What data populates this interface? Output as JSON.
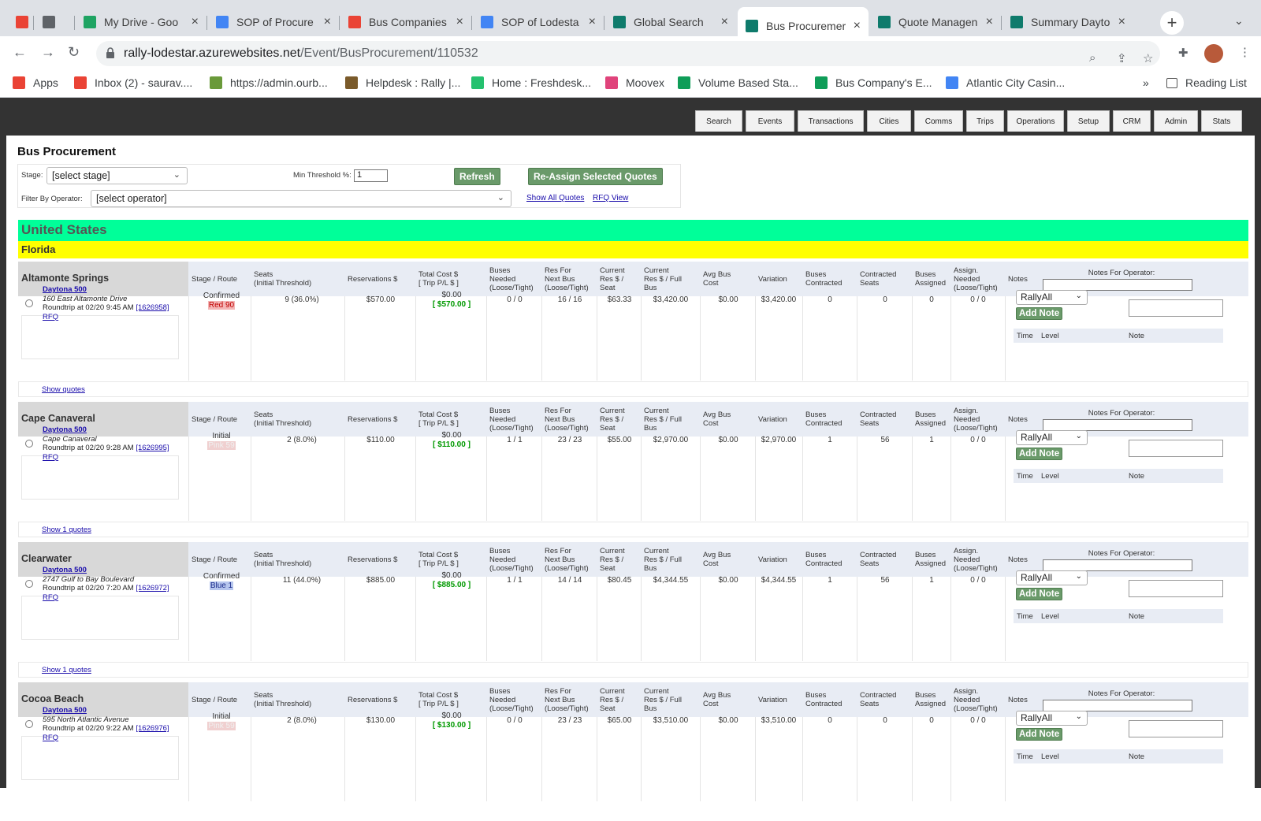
{
  "browser": {
    "tabs": [
      {
        "title": "",
        "icon": "gmail-icon",
        "color": "#ea4335"
      },
      {
        "title": "",
        "icon": "globe-icon",
        "color": "#5f6368"
      },
      {
        "title": "My Drive - Goo",
        "icon": "google-drive-icon",
        "color": "#1fa463"
      },
      {
        "title": "SOP of Procure",
        "icon": "google-docs-icon",
        "color": "#4285f4"
      },
      {
        "title": "Bus Companies",
        "icon": "google-maps-icon",
        "color": "#ea4335"
      },
      {
        "title": "SOP of Lodesta",
        "icon": "google-docs-icon",
        "color": "#4285f4"
      },
      {
        "title": "Global Search",
        "icon": "rally-icon",
        "color": "#0f7b6c"
      },
      {
        "title": "Bus Procuremer",
        "icon": "rally-icon",
        "color": "#0f7b6c",
        "active": true
      },
      {
        "title": "Quote Managen",
        "icon": "rally-icon",
        "color": "#0f7b6c"
      },
      {
        "title": "Summary Dayto",
        "icon": "rally-icon",
        "color": "#0f7b6c"
      }
    ],
    "url_host": "rally-lodestar.azurewebsites.net",
    "url_path": "/Event/BusProcurement/110532",
    "bookmarks": [
      {
        "label": "Apps",
        "icon": "apps-grid-icon",
        "color": "#ea4335"
      },
      {
        "label": "Inbox (2) - saurav....",
        "icon": "gmail-icon",
        "color": "#ea4335"
      },
      {
        "label": "https://admin.ourb...",
        "icon": "image-icon",
        "color": "#6a9a3a"
      },
      {
        "label": "Helpdesk : Rally |...",
        "icon": "helpdesk-icon",
        "color": "#7a5a2a"
      },
      {
        "label": "Home : Freshdesk...",
        "icon": "phone-icon",
        "color": "#25c16f"
      },
      {
        "label": "Moovex",
        "icon": "moovex-icon",
        "color": "#e0437b"
      },
      {
        "label": "Volume Based Sta...",
        "icon": "google-sheets-icon",
        "color": "#0f9d58"
      },
      {
        "label": "Bus Company's E...",
        "icon": "google-sheets-icon",
        "color": "#0f9d58"
      },
      {
        "label": "Atlantic City Casin...",
        "icon": "google-docs-icon",
        "color": "#4285f4"
      }
    ],
    "more_bookmarks": "»",
    "reading_list": "Reading List"
  },
  "nav": [
    "Search",
    "Events",
    "Transactions",
    "Cities",
    "Comms",
    "Trips",
    "Operations",
    "Setup",
    "CRM",
    "Admin",
    "Stats"
  ],
  "page": {
    "title": "Bus Procurement",
    "stage_label": "Stage:",
    "stage_value": "[select stage]",
    "threshold_label": "Min Threshold %:",
    "threshold_value": "1",
    "refresh": "Refresh",
    "reassign": "Re-Assign Selected Quotes",
    "operator_label": "Filter By Operator:",
    "operator_value": "[select operator]",
    "show_all_quotes": "Show All Quotes",
    "rfq_view": "RFQ View",
    "country": "United States",
    "state": "Florida"
  },
  "columns": {
    "stage": "Stage / Route",
    "seats": "Seats\n(Initial Threshold)",
    "reservations": "Reservations $",
    "total_cost": "Total Cost $\n[ Trip P/L $ ]",
    "buses_needed": "Buses\nNeeded\n(Loose/Tight)",
    "res_next": "Res For\nNext Bus\n(Loose/Tight)",
    "res_seat": "Current\nRes $ /\nSeat",
    "res_full": "Current\nRes $ / Full\nBus",
    "avg_cost": "Avg Bus\nCost",
    "variation": "Variation",
    "buses_contracted": "Buses\nContracted",
    "contracted_seats": "Contracted\nSeats",
    "buses_assigned": "Buses\nAssigned",
    "assign_needed": "Assign.\nNeeded\n(Loose/Tight)",
    "notes": "Notes"
  },
  "notes_ui": {
    "for_operator": "Notes For Operator:",
    "level": "RallyAll",
    "add": "Add Note",
    "time": "Time",
    "level_hdr": "Level",
    "note": "Note"
  },
  "rows": [
    {
      "city": "Altamonte Springs",
      "event": "Daytona 500",
      "address": "160 East Altamonte Drive",
      "trip": "Roundtrip at 02/20 9:45 AM",
      "trip_id": "[1626958]",
      "rfq": "RFQ",
      "stage": "Confirmed",
      "route": "Red 90",
      "route_bg": "#f4b6b6",
      "route_fg": "#c00000",
      "seats": "9",
      "pct": "(36.0%)",
      "reservations": "$570.00",
      "total_cost": "$0.00",
      "pl": "[ $570.00 ]",
      "buses_needed": "0 / 0",
      "res_next": "16 / 16",
      "res_seat": "$63.33",
      "res_full": "$3,420.00",
      "avg_cost": "$0.00",
      "variation": "$3,420.00",
      "buses_contracted": "0",
      "contracted_seats": "0",
      "buses_assigned": "0",
      "assign_needed": "0 / 0",
      "show": "Show quotes"
    },
    {
      "city": "Cape Canaveral",
      "event": "Daytona 500",
      "address": "Cape Canaveral",
      "trip": "Roundtrip at 02/20 9:28 AM",
      "trip_id": "[1626995]",
      "rfq": "RFQ",
      "stage": "Initial",
      "route": "Pink 59",
      "route_bg": "#f0d0d0",
      "route_fg": "#f0f0f0",
      "seats": "2",
      "pct": "(8.0%)",
      "reservations": "$110.00",
      "total_cost": "$0.00",
      "pl": "[ $110.00 ]",
      "buses_needed": "1 / 1",
      "res_next": "23 / 23",
      "res_seat": "$55.00",
      "res_full": "$2,970.00",
      "avg_cost": "$0.00",
      "variation": "$2,970.00",
      "buses_contracted": "1",
      "contracted_seats": "56",
      "buses_assigned": "1",
      "assign_needed": "0 / 0",
      "show": "Show 1 quotes"
    },
    {
      "city": "Clearwater",
      "event": "Daytona 500",
      "address": "2747 Gulf to Bay Boulevard",
      "trip": "Roundtrip at 02/20 7:20 AM",
      "trip_id": "[1626972]",
      "rfq": "RFQ",
      "stage": "Confirmed",
      "route": "Blue 1",
      "route_bg": "#b6c6ee",
      "route_fg": "#1a2a8a",
      "seats": "11",
      "pct": "(44.0%)",
      "reservations": "$885.00",
      "total_cost": "$0.00",
      "pl": "[ $885.00 ]",
      "buses_needed": "1 / 1",
      "res_next": "14 / 14",
      "res_seat": "$80.45",
      "res_full": "$4,344.55",
      "avg_cost": "$0.00",
      "variation": "$4,344.55",
      "buses_contracted": "1",
      "contracted_seats": "56",
      "buses_assigned": "1",
      "assign_needed": "0 / 0",
      "show": "Show 1 quotes"
    },
    {
      "city": "Cocoa Beach",
      "event": "Daytona 500",
      "address": "595 North Atlantic Avenue",
      "trip": "Roundtrip at 02/20 9:22 AM",
      "trip_id": "[1626976]",
      "rfq": "RFQ",
      "stage": "Initial",
      "route": "Pink 59",
      "route_bg": "#f0d0d0",
      "route_fg": "#f0f0f0",
      "seats": "2",
      "pct": "(8.0%)",
      "reservations": "$130.00",
      "total_cost": "$0.00",
      "pl": "[ $130.00 ]",
      "buses_needed": "0 / 0",
      "res_next": "23 / 23",
      "res_seat": "$65.00",
      "res_full": "$3,510.00",
      "avg_cost": "$0.00",
      "variation": "$3,510.00",
      "buses_contracted": "0",
      "contracted_seats": "0",
      "buses_assigned": "0",
      "assign_needed": "0 / 0",
      "show": ""
    }
  ]
}
